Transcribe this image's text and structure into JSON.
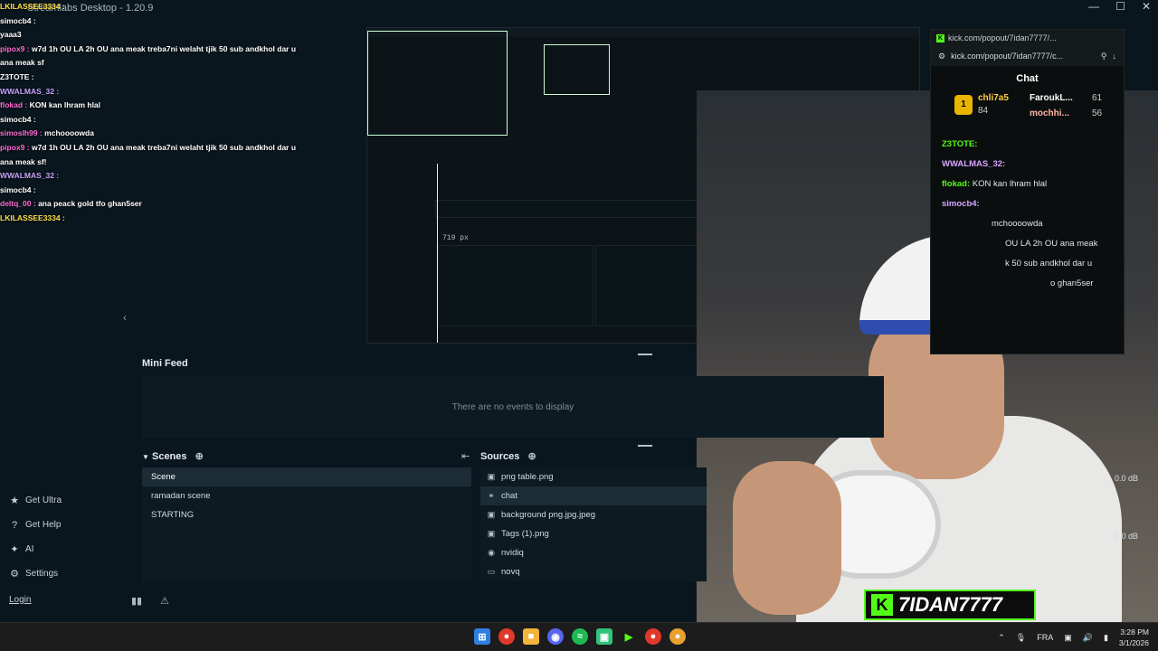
{
  "app": {
    "title": "Streamlabs Desktop - 1.20.9"
  },
  "chat_overlay": [
    {
      "user": "LKILASSEE3334 :",
      "msg": "",
      "color": "#ffe14b"
    },
    {
      "user": "simocb4 :",
      "msg": "",
      "color": "#ffffff"
    },
    {
      "user": "",
      "msg": "yaaa3",
      "color": "#ffffff"
    },
    {
      "user": "pipox9 :",
      "msg": "w7d 1h OU LA 2h OU ana meak treba7ni welaht tjik 50 sub andkhol dar u",
      "color": "#ff6bd3"
    },
    {
      "user": "",
      "msg": "ana meak sf",
      "color": "#ffffff"
    },
    {
      "user": "Z3TOTE :",
      "msg": "",
      "color": "#ffffff"
    },
    {
      "user": "WWALMAS_32 :",
      "msg": "",
      "color": "#c8a2ff"
    },
    {
      "user": "flokad :",
      "msg": "KON kan lhram hlal",
      "color": "#ff6bd3"
    },
    {
      "user": "simocb4 :",
      "msg": "",
      "color": "#ffffff"
    },
    {
      "user": "simoslh99 :",
      "msg": "mchoooowda",
      "color": "#ff6bd3"
    },
    {
      "user": "pipox9 :",
      "msg": "w7d 1h OU LA 2h OU ana meak treba7ni welaht tjik 50 sub andkhol dar u",
      "color": "#ff6bd3"
    },
    {
      "user": "",
      "msg": "ana meak sf!",
      "color": "#ffffff"
    },
    {
      "user": "WWALMAS_32 :",
      "msg": "",
      "color": "#c8a2ff"
    },
    {
      "user": "simocb4 :",
      "msg": "",
      "color": "#ffffff"
    },
    {
      "user": "deltq_00 :",
      "msg": "ana peack gold tfo ghan5ser",
      "color": "#ff6bd3"
    },
    {
      "user": "LKILASSEE3334 :",
      "msg": "",
      "color": "#ffe14b"
    }
  ],
  "sidebar": {
    "items": [
      {
        "label": "Get Ultra",
        "icon": "ultra-icon"
      },
      {
        "label": "Get Help",
        "icon": "help-icon"
      },
      {
        "label": "AI",
        "icon": "ai-icon"
      },
      {
        "label": "Settings",
        "icon": "gear-icon"
      }
    ],
    "login": "Login"
  },
  "preview": {
    "resize_readout": "719 px"
  },
  "mini_feed": {
    "title": "Mini Feed",
    "empty": "There are no events to display"
  },
  "scenes": {
    "title": "Scenes",
    "items": [
      "Scene",
      "ramadan scene",
      "STARTING"
    ]
  },
  "sources": {
    "title": "Sources",
    "items": [
      {
        "label": "png table.png",
        "icon": "image-icon"
      },
      {
        "label": "chat",
        "icon": "globe-icon"
      },
      {
        "label": "background png.jpg.jpeg",
        "icon": "image-icon"
      },
      {
        "label": "Tags (1).png",
        "icon": "image-icon"
      },
      {
        "label": "nvidiq",
        "icon": "capture-icon"
      },
      {
        "label": "novq",
        "icon": "display-icon"
      }
    ]
  },
  "mixer": {
    "db1": "0.0 dB",
    "db2": "0.0 dB"
  },
  "kick_window": {
    "tab": "kick.com/popout/7idan7777/...",
    "url": "kick.com/popout/7idan7777/c...",
    "chat_title": "Chat",
    "leaders": [
      {
        "name": "chli7a5",
        "value": "84",
        "rank": "1"
      },
      {
        "name": "FaroukL...",
        "value": "61"
      },
      {
        "name": "mochhi...",
        "value": "56"
      }
    ],
    "messages": [
      {
        "user": "Z3TOTE:",
        "msg": "",
        "cls": "u1"
      },
      {
        "user": "WWALMAS_32:",
        "msg": "",
        "cls": "u2"
      },
      {
        "user": "flokad:",
        "msg": "KON kan lhram hlal",
        "cls": "u1"
      },
      {
        "user": "simocb4:",
        "msg": "",
        "cls": "u2"
      },
      {
        "user": "",
        "msg": "mchoooowda",
        "cls": "u1"
      },
      {
        "user": "",
        "msg": "OU LA 2h OU ana meak",
        "cls": "u1"
      },
      {
        "user": "",
        "msg": "k 50 sub andkhol dar u",
        "cls": "u1"
      },
      {
        "user": "",
        "msg": "o ghan5ser",
        "cls": "u1"
      }
    ]
  },
  "webcam": {
    "streamer_tag": "7IDAN7777"
  },
  "taskbar": {
    "language": "FRA",
    "time": "3:28 PM",
    "date": "3/1/2026"
  },
  "colors": {
    "kick_green": "#53fc18",
    "bg": "#09161d",
    "panel": "#0c1a21"
  }
}
